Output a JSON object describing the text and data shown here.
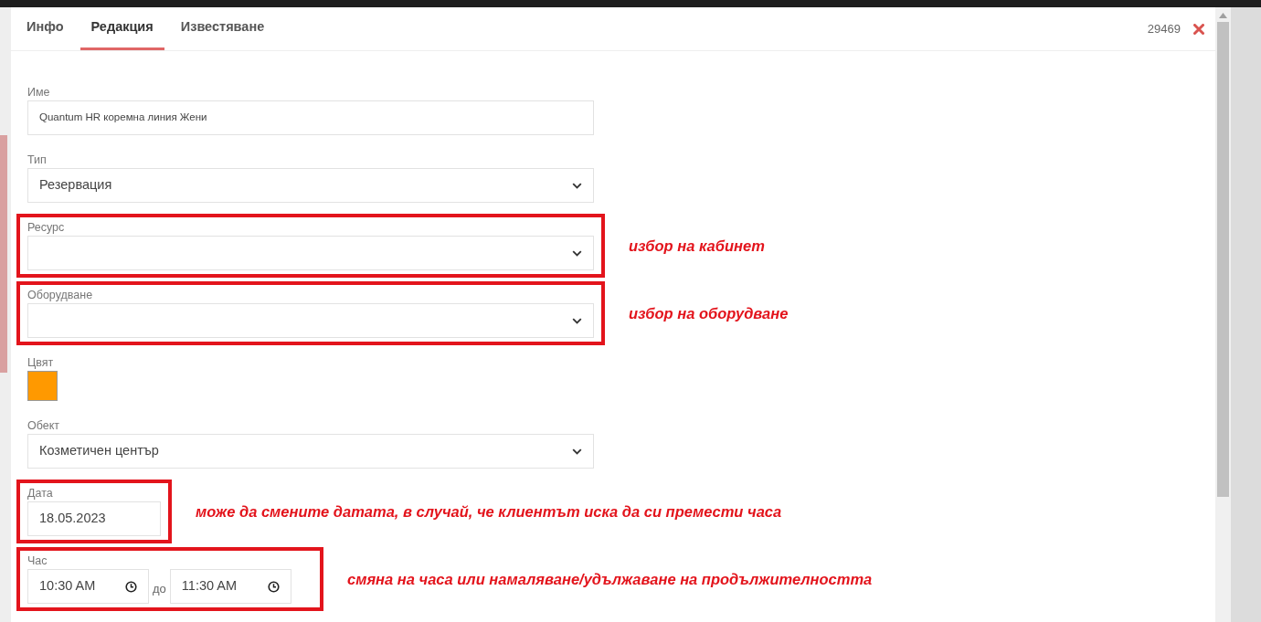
{
  "tabs": [
    {
      "label": "Инфо",
      "selected": false
    },
    {
      "label": "Редакция",
      "selected": true
    },
    {
      "label": "Известяване",
      "selected": false
    }
  ],
  "record_id": "29469",
  "fields": [
    {
      "kind": "text",
      "label": "Име",
      "value": "Quantum HR коремна линия Жени",
      "highlighted": false
    },
    {
      "kind": "select",
      "label": "Тип",
      "value": "Резервация",
      "highlighted": false
    },
    {
      "kind": "select",
      "label": "Ресурс",
      "highlighted": true,
      "note": "избор на кабинет"
    },
    {
      "kind": "select",
      "label": "Оборудване",
      "highlighted": true,
      "note": "избор на оборудване"
    },
    {
      "kind": "color",
      "label": "Цвят",
      "color": "#ff9900",
      "highlighted": false
    },
    {
      "kind": "select",
      "label": "Обект",
      "value": "Козметичен център",
      "highlighted": false
    },
    {
      "kind": "date",
      "label": "Дата",
      "value": "18.05.2023",
      "highlighted": true,
      "note": "може да смените датата, в случай, че клиентът иска да си премести часа"
    },
    {
      "kind": "time_range",
      "label": "Час",
      "from": "10:30 AM",
      "separator": "до",
      "to": "11:30 AM",
      "highlighted": true,
      "note": "смяна на часа или намаляване/удължаване на продължителността"
    }
  ]
}
